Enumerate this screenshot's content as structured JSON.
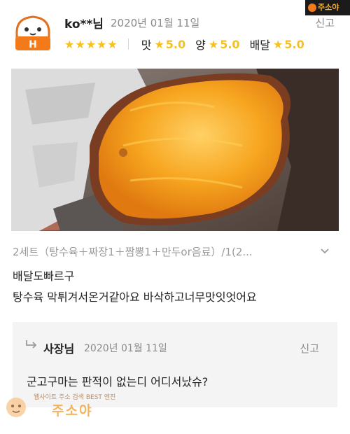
{
  "review": {
    "nickname": "ko**님",
    "date": "2020년 01월 11일",
    "report_label": "신고",
    "stars": "★★★★★",
    "ratings": [
      {
        "label": "맛",
        "star": "★",
        "value": "5.0"
      },
      {
        "label": "양",
        "star": "★",
        "value": "5.0"
      },
      {
        "label": "배달",
        "star": "★",
        "value": "5.0"
      }
    ],
    "order_menu": "2세트（탕수육＋짜장1＋짬뽕1＋만두or음료）/1(2...",
    "text_line1": "배달도빠르구",
    "text_line2": "탕수육 막튀겨서온거같아요 바삭하고너무맛잇엇어요"
  },
  "reply": {
    "owner_label": "사장님",
    "date": "2020년 01월 11일",
    "report_label": "신고",
    "text": "군고구마는 판적이 없는디 어디서났슈?"
  },
  "watermark": {
    "top_text": "주소야",
    "bottom_small": "웹사이트 주소 검색 BEST 엔진",
    "bottom_big": "주소야"
  },
  "colors": {
    "star_yellow": "#f7c01e",
    "avatar_orange": "#f27a1a",
    "reply_bg": "#f4f4f4",
    "muted_text": "#8a8a8a"
  }
}
